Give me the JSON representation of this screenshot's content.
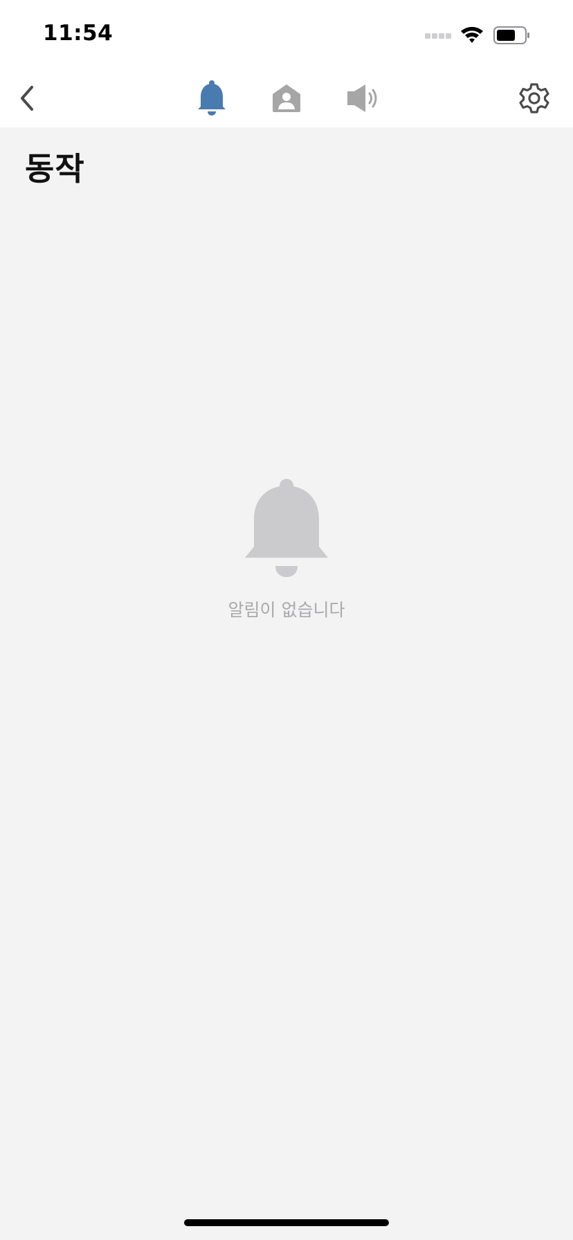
{
  "status_bar": {
    "time": "11:54",
    "icons": [
      "signal-icon",
      "wifi-icon",
      "battery-icon"
    ]
  },
  "nav_bar": {
    "back_icon": "chevron-left-icon",
    "tabs": [
      {
        "icon": "bell-icon",
        "active": true
      },
      {
        "icon": "home-person-icon",
        "active": false
      },
      {
        "icon": "speaker-icon",
        "active": false
      }
    ],
    "settings_icon": "gear-icon"
  },
  "page": {
    "title": "동작"
  },
  "empty_state": {
    "icon": "bell-icon",
    "message": "알림이 없습니다"
  },
  "colors": {
    "active_tab": "#4a7bb0",
    "inactive_tab": "#a6a6a6",
    "background": "#f3f3f3",
    "empty_icon": "#cbcbcd",
    "empty_text": "#a9a9ad"
  }
}
